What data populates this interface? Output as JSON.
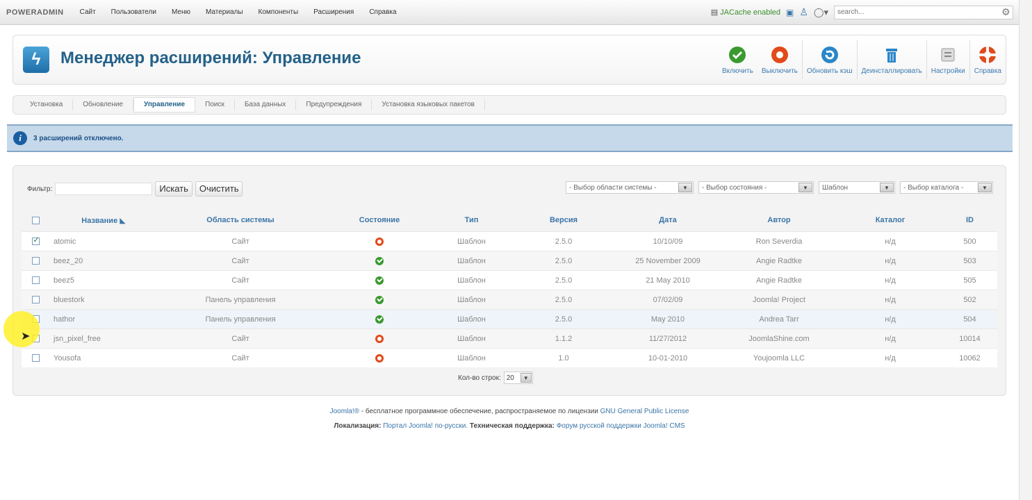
{
  "topbar": {
    "logo": "POWERADMIN",
    "menu": [
      "Сайт",
      "Пользователи",
      "Меню",
      "Материалы",
      "Компоненты",
      "Расширения",
      "Справка"
    ],
    "cache_status": "JACache enabled",
    "search_placeholder": "search..."
  },
  "header": {
    "title": "Менеджер расширений: Управление",
    "toolbar": [
      {
        "label": "Включить",
        "icon": "enable-icon",
        "color": "#3a9a2e"
      },
      {
        "label": "Выключить",
        "icon": "disable-icon",
        "color": "#e14b1c"
      },
      {
        "label": "Обновить кэш",
        "icon": "refresh-cache-icon",
        "color": "#2a86c8"
      },
      {
        "label": "Деинсталлировать",
        "icon": "trash-icon",
        "color": "#2a86c8"
      },
      {
        "label": "Настройки",
        "icon": "options-icon",
        "color": "#888888"
      },
      {
        "label": "Справка",
        "icon": "help-icon",
        "color": "#e14b1c"
      }
    ]
  },
  "tabs": [
    "Установка",
    "Обновление",
    "Управление",
    "Поиск",
    "База данных",
    "Предупреждения",
    "Установка языковых пакетов"
  ],
  "active_tab": "Управление",
  "message": "3 расширений отключено.",
  "filter": {
    "label": "Фильтр:",
    "search_button": "Искать",
    "clear_button": "Очистить",
    "selects": [
      "- Выбор области системы -",
      "- Выбор состояния -",
      "Шаблон",
      "- Выбор каталога -"
    ]
  },
  "table": {
    "headers": [
      "Название",
      "Область системы",
      "Состояние",
      "Тип",
      "Версия",
      "Дата",
      "Автор",
      "Каталог",
      "ID"
    ],
    "rows": [
      {
        "checked": true,
        "name": "atomic",
        "area": "Сайт",
        "state": "off",
        "type": "Шаблон",
        "version": "2.5.0",
        "date": "10/10/09",
        "author": "Ron Severdia",
        "catalog": "н/д",
        "id": "500"
      },
      {
        "checked": false,
        "name": "beez_20",
        "area": "Сайт",
        "state": "on",
        "type": "Шаблон",
        "version": "2.5.0",
        "date": "25 November 2009",
        "author": "Angie Radtke",
        "catalog": "н/д",
        "id": "503"
      },
      {
        "checked": false,
        "name": "beez5",
        "area": "Сайт",
        "state": "on",
        "type": "Шаблон",
        "version": "2.5.0",
        "date": "21 May 2010",
        "author": "Angie Radtke",
        "catalog": "н/д",
        "id": "505"
      },
      {
        "checked": false,
        "name": "bluestork",
        "area": "Панель управления",
        "state": "on",
        "type": "Шаблон",
        "version": "2.5.0",
        "date": "07/02/09",
        "author": "Joomla! Project",
        "catalog": "н/д",
        "id": "502"
      },
      {
        "checked": false,
        "name": "hathor",
        "area": "Панель управления",
        "state": "on",
        "type": "Шаблон",
        "version": "2.5.0",
        "date": "May 2010",
        "author": "Andrea Tarr",
        "catalog": "н/д",
        "id": "504"
      },
      {
        "checked": false,
        "name": "jsn_pixel_free",
        "area": "Сайт",
        "state": "off",
        "type": "Шаблон",
        "version": "1.1.2",
        "date": "11/27/2012",
        "author": "JoomlaShine.com",
        "catalog": "н/д",
        "id": "10014"
      },
      {
        "checked": false,
        "name": "Yousofa",
        "area": "Сайт",
        "state": "off",
        "type": "Шаблон",
        "version": "1.0",
        "date": "10-01-2010",
        "author": "Youjoomla LLC",
        "catalog": "н/д",
        "id": "10062"
      }
    ]
  },
  "pager": {
    "label": "Кол-во строк:",
    "value": "20"
  },
  "footer": {
    "line1_link1": "Joomla!®",
    "line1_text": " - бесплатное программное обеспечение, распространяемое по лицензии ",
    "line1_link2": "GNU General Public License",
    "line2_label1": "Локализация:",
    "line2_link1": " Портал Joomla! по-русски. ",
    "line2_label2": "Техническая поддержка:",
    "line2_link2": " Форум русской поддержки Joomla! CMS"
  }
}
